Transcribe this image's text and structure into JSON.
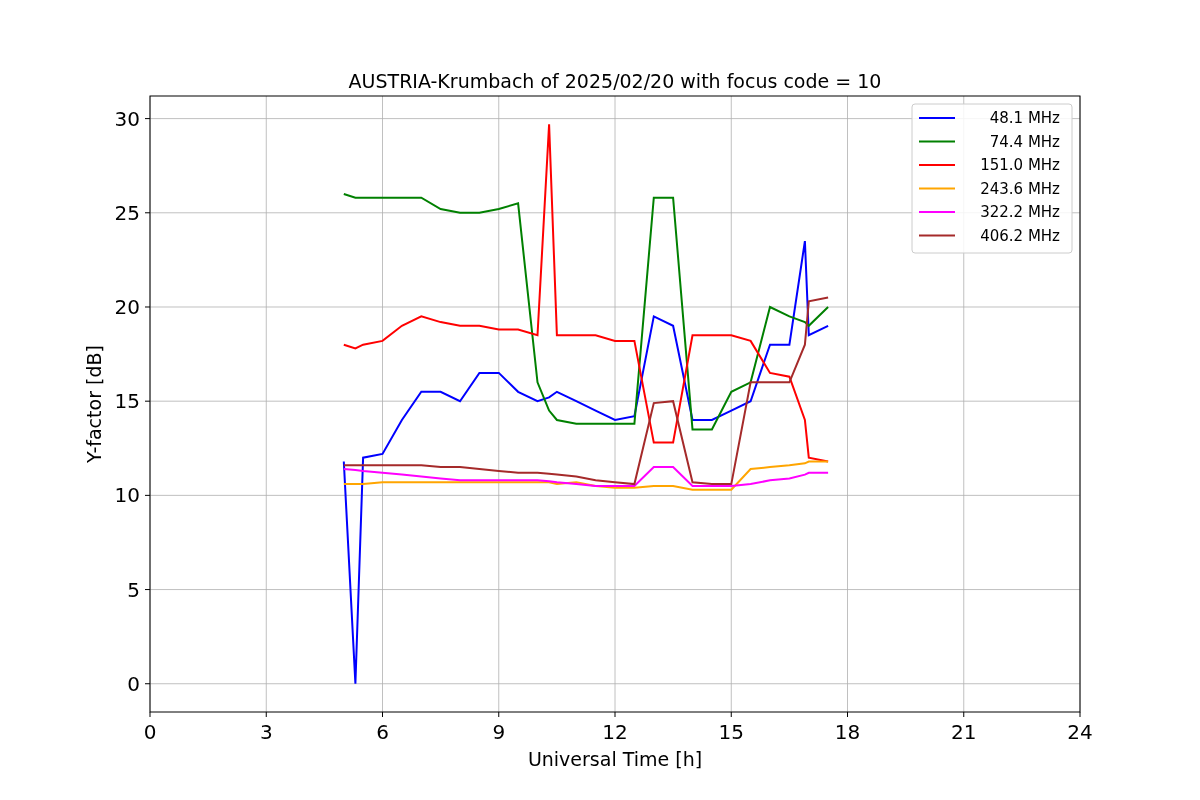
{
  "chart_data": {
    "type": "line",
    "title": "AUSTRIA-Krumbach of 2025/02/20 with focus code = 10",
    "xlabel": "Universal Time [h]",
    "ylabel": "Y-factor [dB]",
    "xlim": [
      0,
      24
    ],
    "ylim": [
      -1.5,
      31.2
    ],
    "xticks": [
      0,
      3,
      6,
      9,
      12,
      15,
      18,
      21,
      24
    ],
    "yticks": [
      0,
      5,
      10,
      15,
      20,
      25,
      30
    ],
    "grid": true,
    "legend": true,
    "x": [
      5,
      5.3,
      5.5,
      6,
      6.5,
      7,
      7.5,
      8,
      8.5,
      9,
      9.5,
      10,
      10.3,
      10.5,
      11,
      11.5,
      12,
      12.5,
      13,
      13.5,
      14,
      14.5,
      15,
      15.5,
      16,
      16.5,
      16.9,
      17,
      17.5
    ],
    "series": [
      {
        "name": " 48.1 MHz",
        "color": "#0000ff",
        "values": [
          11.8,
          0,
          12,
          12.2,
          14,
          15.5,
          15.5,
          15,
          16.5,
          16.5,
          15.5,
          15,
          15.2,
          15.5,
          15,
          14.5,
          14,
          14.2,
          19.5,
          19,
          14,
          14,
          14.5,
          15,
          18,
          18,
          23.5,
          18.5,
          19
        ]
      },
      {
        "name": " 74.4 MHz",
        "color": "#008000",
        "values": [
          26,
          25.8,
          25.8,
          25.8,
          25.8,
          25.8,
          25.2,
          25,
          25,
          25.2,
          25.5,
          16,
          14.5,
          14,
          13.8,
          13.8,
          13.8,
          13.8,
          25.8,
          25.8,
          13.5,
          13.5,
          15.5,
          16,
          20,
          19.5,
          19.2,
          19,
          20
        ]
      },
      {
        "name": "151.0 MHz",
        "color": "#ff0000",
        "values": [
          18,
          17.8,
          18,
          18.2,
          19,
          19.5,
          19.2,
          19,
          19,
          18.8,
          18.8,
          18.5,
          29.7,
          18.5,
          18.5,
          18.5,
          18.2,
          18.2,
          12.8,
          12.8,
          18.5,
          18.5,
          18.5,
          18.2,
          16.5,
          16.3,
          14,
          12,
          11.8
        ]
      },
      {
        "name": "243.6 MHz",
        "color": "#ffa500",
        "values": [
          10.6,
          10.6,
          10.6,
          10.7,
          10.7,
          10.7,
          10.7,
          10.7,
          10.7,
          10.7,
          10.7,
          10.7,
          10.7,
          10.6,
          10.7,
          10.5,
          10.4,
          10.4,
          10.5,
          10.5,
          10.3,
          10.3,
          10.3,
          11.4,
          11.5,
          11.6,
          11.7,
          11.8,
          11.8
        ]
      },
      {
        "name": "322.2 MHz",
        "color": "#ff00ff",
        "values": [
          11.4,
          11.35,
          11.3,
          11.2,
          11.1,
          11,
          10.9,
          10.8,
          10.8,
          10.8,
          10.8,
          10.8,
          10.75,
          10.7,
          10.6,
          10.5,
          10.5,
          10.5,
          11.5,
          11.5,
          10.5,
          10.5,
          10.5,
          10.6,
          10.8,
          10.9,
          11.1,
          11.2,
          11.2
        ]
      },
      {
        "name": "406.2 MHz",
        "color": "#a52a2a",
        "values": [
          11.6,
          11.6,
          11.6,
          11.6,
          11.6,
          11.6,
          11.5,
          11.5,
          11.4,
          11.3,
          11.2,
          11.2,
          11.15,
          11.1,
          11,
          10.8,
          10.7,
          10.6,
          14.9,
          15,
          10.7,
          10.6,
          10.6,
          16,
          16,
          16,
          18,
          20.3,
          20.5
        ]
      }
    ]
  }
}
